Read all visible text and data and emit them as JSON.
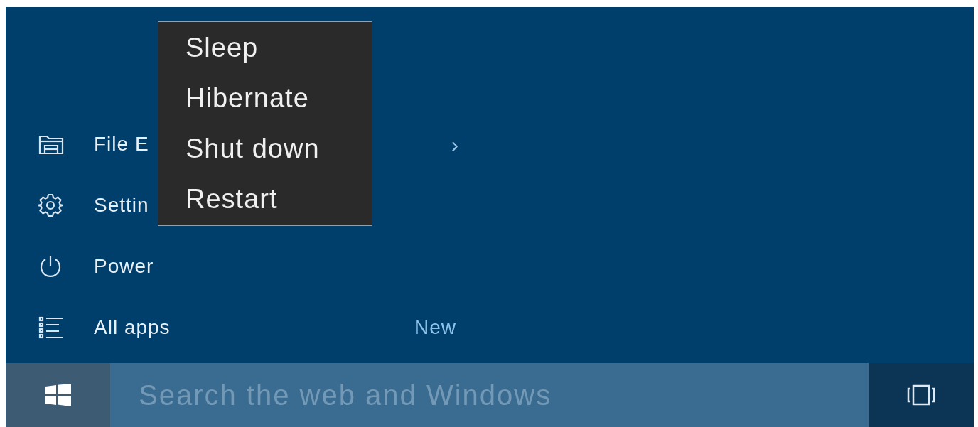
{
  "start_menu": {
    "items": [
      {
        "kind": "folder",
        "label": "File E",
        "chevron": "›"
      },
      {
        "kind": "gear",
        "label": "Settin"
      },
      {
        "kind": "power",
        "label": "Power"
      },
      {
        "kind": "list",
        "label": "All apps",
        "badge": "New"
      }
    ]
  },
  "power_menu": {
    "items": [
      "Sleep",
      "Hibernate",
      "Shut down",
      "Restart"
    ]
  },
  "taskbar": {
    "search": {
      "placeholder": "Search the web and Windows"
    }
  }
}
